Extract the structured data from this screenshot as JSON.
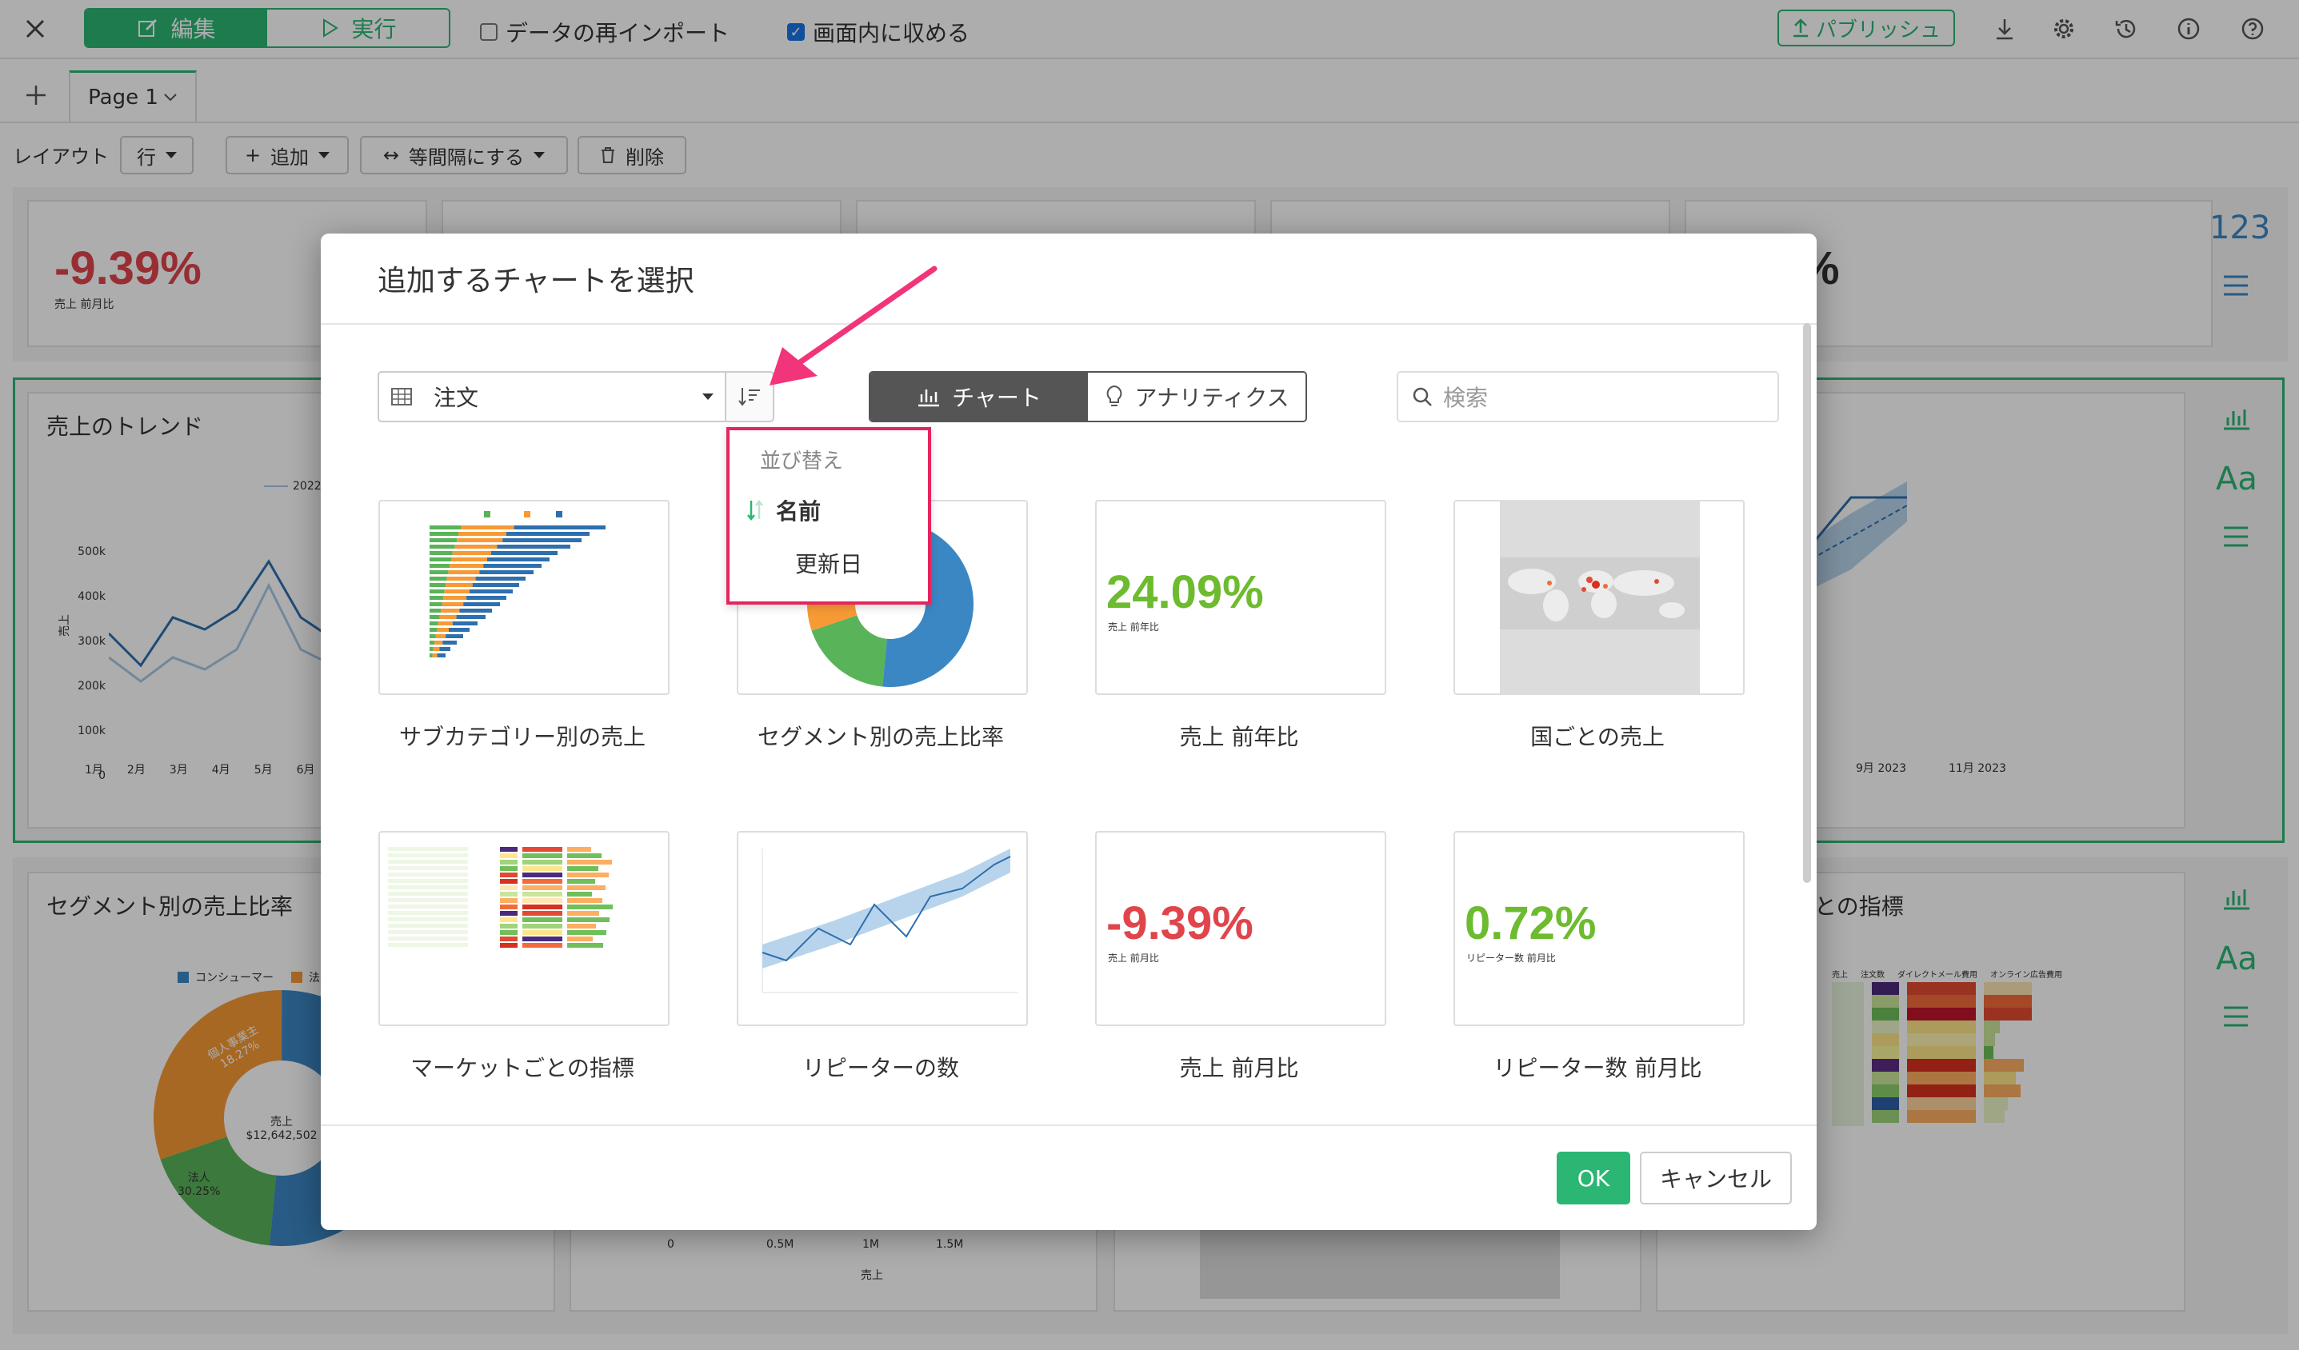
{
  "topbar": {
    "mode_edit": "編集",
    "mode_run": "実行",
    "reimport_label": "データの再インポート",
    "fit_label": "画面内に収める",
    "fit_checked": true,
    "publish_label": "パブリッシュ"
  },
  "page_tab": {
    "label": "Page 1"
  },
  "layout_bar": {
    "layout_label": "レイアウト",
    "row_label": "行",
    "add_label": "追加",
    "equal_label": "等間隔にする",
    "delete_label": "削除"
  },
  "dashboard": {
    "kpi1_value": "-9.39%",
    "kpi1_caption": "売上 前月比",
    "kpi5_value_fragment": "%",
    "side_number": "123",
    "trend_title": "売上のトレンド",
    "trend_legend": "2022",
    "trend_ylabel": "売上",
    "trend_yticks": [
      "500k",
      "400k",
      "300k",
      "200k",
      "100k",
      "0"
    ],
    "trend_xticks": [
      "1月",
      "2月",
      "3月",
      "4月",
      "5月",
      "6月"
    ],
    "repeater_xticks": [
      "9月 2023",
      "11月 2023"
    ],
    "segment_title": "セグメント別の売上比率",
    "segment_legend": [
      "コンシューマー",
      "法人"
    ],
    "donut_center_label": "売上",
    "donut_center_value": "$12,642,502",
    "donut_slices": [
      {
        "name": "個人事業主",
        "pct": "18.27%",
        "value": 18.27,
        "color": "#59b359"
      },
      {
        "name": "法人",
        "pct": "30.25%",
        "value": 30.25,
        "color": "#f79a35"
      },
      {
        "name": "コンシューマー",
        "pct": "51.48%",
        "value": 51.48,
        "color": "#3b87c4"
      }
    ],
    "bar_xticks": [
      "0",
      "0.5M",
      "1M",
      "1.5M"
    ],
    "bar_xlabel": "売上",
    "market_title_fragment": "との指標",
    "market_headers": [
      "売上",
      "注文数",
      "ダイレクトメール費用",
      "オンライン広告費用"
    ]
  },
  "modal": {
    "title": "追加するチャートを選択",
    "source_label": "注文",
    "type_chart": "チャート",
    "type_analytics": "アナリティクス",
    "search_placeholder": "検索",
    "sort_menu": {
      "header": "並び替え",
      "option_name": "名前",
      "option_date": "更新日"
    },
    "tiles": [
      {
        "label": "サブカテゴリー別の売上"
      },
      {
        "label": "セグメント別の売上比率"
      },
      {
        "label": "売上 前年比",
        "value": "24.09%",
        "caption": "売上 前年比"
      },
      {
        "label": "国ごとの売上"
      },
      {
        "label": "マーケットごとの指標"
      },
      {
        "label": "リピーターの数"
      },
      {
        "label": "売上 前月比",
        "value": "-9.39%",
        "caption": "売上 前月比"
      },
      {
        "label": "リピーター数 前月比",
        "value": "0.72%",
        "caption": "リピーター数 前月比"
      }
    ],
    "ok_label": "OK",
    "cancel_label": "キャンセル"
  },
  "colors": {
    "accent_green": "#2bb673",
    "negative_red": "#e0454c",
    "positive_green": "#6dbb2f",
    "highlight_pink": "#e6245e"
  }
}
